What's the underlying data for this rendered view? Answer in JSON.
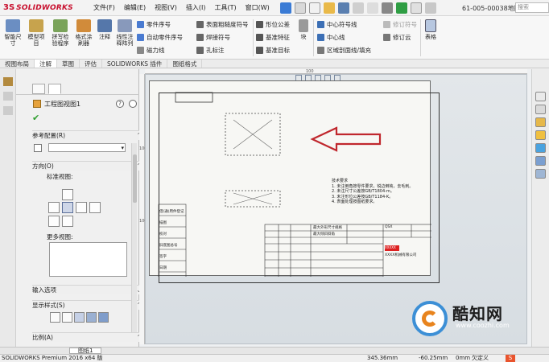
{
  "app": {
    "brand": "SOLIDWORKS",
    "document_title": "61-005-00038地脚...",
    "search_placeholder": "搜索"
  },
  "menu": [
    "文件(F)",
    "编辑(E)",
    "视图(V)",
    "插入(I)",
    "工具(T)",
    "窗口(W)"
  ],
  "ribbon": {
    "big_buttons": [
      "智能尺寸",
      "模型项目",
      "拼写检验程序",
      "格式涂刷器",
      "注释",
      "线性注释阵列",
      "块",
      "表格"
    ],
    "annotation_rows": [
      "零件序号",
      "自动零件序号",
      "磁力线"
    ],
    "symbol_rows": [
      "表面粗糙度符号",
      "焊接符号",
      "孔标注"
    ],
    "tolerance_rows": [
      "形位公差",
      "基准特征",
      "基准目标"
    ],
    "center_rows": [
      "中心符号线",
      "中心线",
      "区域剖面线/填充"
    ],
    "revision_rows": [
      "修订符号",
      "修订云"
    ]
  },
  "command_tabs": [
    {
      "label": "视图布局",
      "active": false
    },
    {
      "label": "注解",
      "active": true
    },
    {
      "label": "草图",
      "active": false
    },
    {
      "label": "评估",
      "active": false
    },
    {
      "label": "SOLIDWORKS 插件",
      "active": false
    },
    {
      "label": "图纸格式",
      "active": false
    }
  ],
  "property_manager": {
    "title": "工程图视图1",
    "ok_symbol": "✔",
    "help_symbol": "?",
    "reference_config_label": "参考配置(R)",
    "orientation_label": "方向(O)",
    "standard_views_label": "标准视图:",
    "more_views_label": "更多视图:",
    "import_options_label": "输入选项",
    "display_style_label": "显示样式(S)",
    "scale_label": "比例(A)"
  },
  "ruler": {
    "h_tick": "100",
    "v_ticks": [
      "100",
      "100"
    ]
  },
  "drawing": {
    "tech_title": "技术要求",
    "tech_notes": [
      "1. 未注倒角按零件要求，锐边倒钝，去毛刺。",
      "2. 未注尺寸公差按GB/T1804-m。",
      "3. 未注形位公差按GB/T1184-K。",
      "4. 表面处理按图纸要求。"
    ],
    "left_block": [
      "借(通)用件登记",
      "描图",
      "校对",
      "旧底图总号",
      "签字",
      "日期"
    ],
    "title_rows": [
      "最大外形尺寸规格",
      "最大倾斜斜角"
    ],
    "title_code": "QSX",
    "title_company": "XXXX机械有限公司",
    "title_logo": "XXXXX"
  },
  "sheet_tabs": [
    "图纸1"
  ],
  "status": {
    "product": "SOLIDWORKS Premium 2016 x64 版",
    "x": "345.36mm",
    "y": "-60.25mm",
    "z": "0mm",
    "state": "欠定义"
  },
  "watermark": {
    "name": "酷知网",
    "url": "www.coozhi.com"
  }
}
